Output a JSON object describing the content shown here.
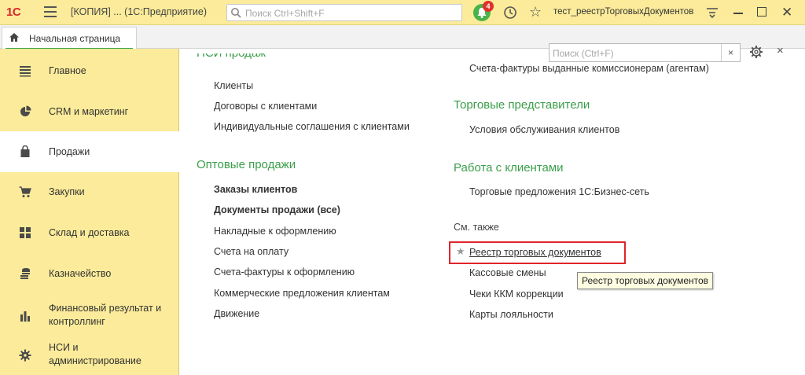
{
  "topbar": {
    "logo": "1С",
    "app_title": "[КОПИЯ] ...  (1С:Предприятие)",
    "search_placeholder": "Поиск Ctrl+Shift+F",
    "notification_count": "4",
    "user": "тест_реестрТорговыхДокументов"
  },
  "tabs": {
    "home_label": "Начальная страница"
  },
  "sidebar": {
    "items": [
      {
        "label": "Главное",
        "icon": "list-icon"
      },
      {
        "label": "CRM и маркетинг",
        "icon": "pie-chart-icon"
      },
      {
        "label": "Продажи",
        "icon": "shopping-bag-icon"
      },
      {
        "label": "Закупки",
        "icon": "cart-icon"
      },
      {
        "label": "Склад и доставка",
        "icon": "grid-icon"
      },
      {
        "label": "Казначейство",
        "icon": "coins-icon"
      },
      {
        "label": "Финансовый результат и\nконтроллинг",
        "icon": "bar-chart-icon"
      },
      {
        "label": "НСИ и\nадминистрирование",
        "icon": "gear-icon"
      }
    ],
    "active_index": 2
  },
  "panel": {
    "search_placeholder": "Поиск (Ctrl+F)",
    "search_clear": "×",
    "close": "×",
    "left_column": {
      "cut_heading": "НСИ продаж",
      "nsi_links": [
        "Клиенты",
        "Договоры с клиентами",
        "Индивидуальные соглашения с клиентами"
      ],
      "wholesale_heading": "Оптовые продажи",
      "wholesale_links": [
        {
          "label": "Заказы клиентов",
          "bold": true
        },
        {
          "label": "Документы продажи (все)",
          "bold": true
        },
        {
          "label": "Накладные к оформлению",
          "bold": false
        },
        {
          "label": "Счета на оплату",
          "bold": false
        },
        {
          "label": "Счета-фактуры к оформлению",
          "bold": false
        },
        {
          "label": "Коммерческие предложения клиентам",
          "bold": false
        },
        {
          "label": "Движение",
          "bold": false
        }
      ]
    },
    "right_column": {
      "top_link": "Счета-фактуры выданные комиссионерам (агентам)",
      "reps_heading": "Торговые представители",
      "reps_links": [
        "Условия обслуживания клиентов"
      ],
      "clients_heading": "Работа с клиентами",
      "clients_links": [
        "Торговые предложения 1С:Бизнес-сеть"
      ],
      "see_also_label": "См. также",
      "see_also_links": [
        "Реестр торговых документов",
        "Кассовые смены",
        "Чеки ККМ коррекции",
        "Карты лояльности"
      ]
    },
    "tooltip": "Реестр торговых документов"
  },
  "colors": {
    "accent_yellow": "#fbeb9a",
    "heading_green": "#3a9e4a",
    "highlight_red": "#e0242a"
  }
}
